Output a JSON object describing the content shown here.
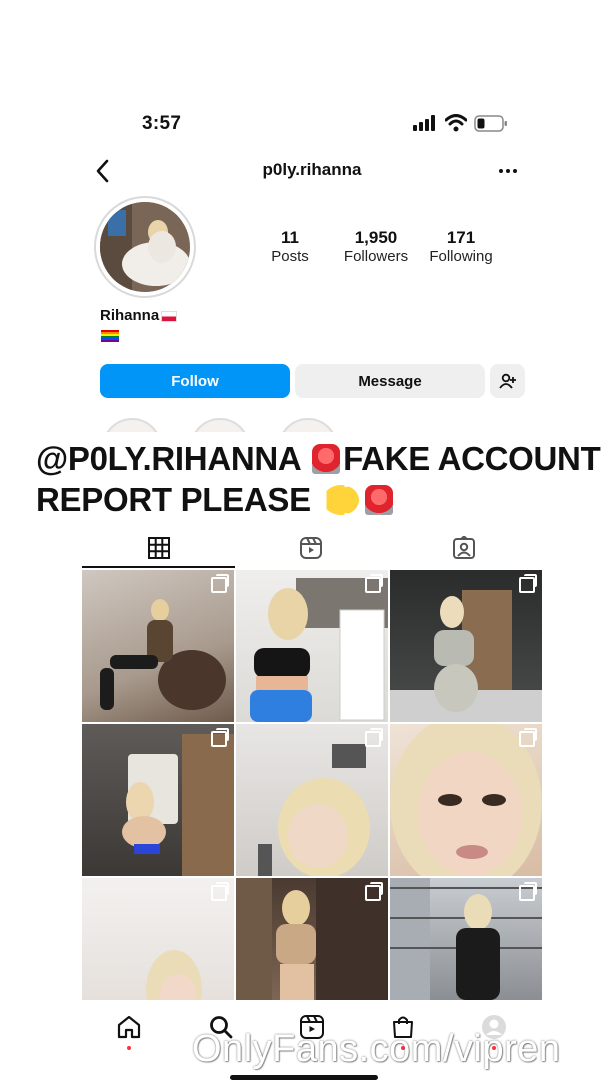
{
  "status_bar": {
    "time": "3:57"
  },
  "header": {
    "username": "p0ly.rihanna",
    "back_icon": "chevron-left-icon",
    "more_icon": "more-horizontal-icon"
  },
  "profile": {
    "stats": [
      {
        "value": "11",
        "label": "Posts"
      },
      {
        "value": "1,950",
        "label": "Followers"
      },
      {
        "value": "171",
        "label": "Following"
      }
    ],
    "display_name": "Rihanna"
  },
  "actions": {
    "follow_label": "Follow",
    "message_label": "Message",
    "follow_color": "#0095f6"
  },
  "banner": {
    "line1": "@P0LY.RIHANNA",
    "line1b": "FAKE ACCOUNT",
    "line2": "REPORT PLEASE"
  },
  "tabs": [
    {
      "name": "grid",
      "icon": "grid-icon",
      "active": true
    },
    {
      "name": "reels",
      "icon": "reels-icon",
      "active": false
    },
    {
      "name": "tagged",
      "icon": "tagged-icon",
      "active": false
    }
  ],
  "posts": [
    {
      "description": "photo"
    },
    {
      "description": "photo"
    },
    {
      "description": "photo"
    },
    {
      "description": "photo"
    },
    {
      "description": "photo"
    },
    {
      "description": "photo"
    },
    {
      "description": "photo"
    },
    {
      "description": "photo"
    },
    {
      "description": "photo"
    }
  ],
  "bottom_nav": [
    "home-icon",
    "search-icon",
    "reels-icon",
    "shop-icon",
    "profile-icon"
  ],
  "watermark": "OnlyFans.com/vipren"
}
